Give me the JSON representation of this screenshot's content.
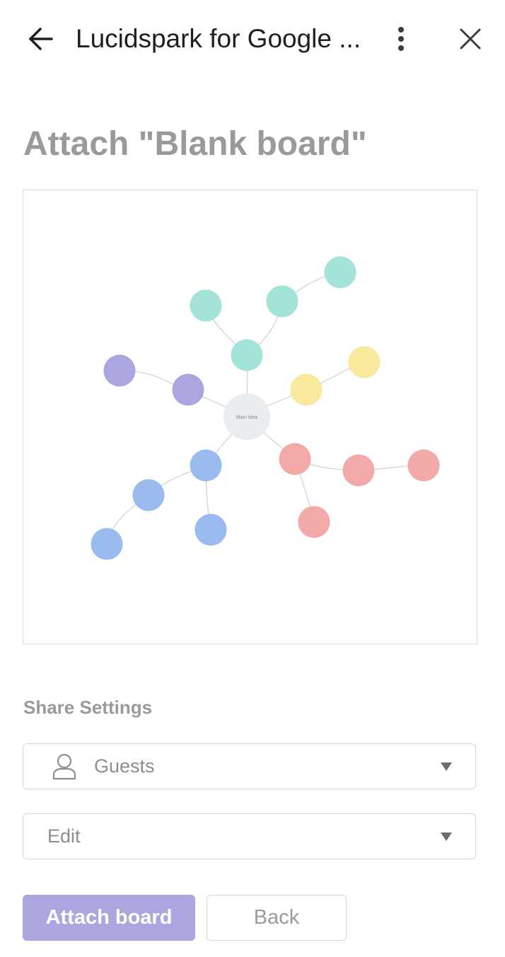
{
  "header": {
    "title": "Lucidspark for Google ...",
    "back_icon": "arrow-left-icon",
    "menu_icon": "more-vertical-icon",
    "close_icon": "close-icon"
  },
  "page_title": "Attach \"Blank board\"",
  "preview": {
    "center_label": "Main idea",
    "colors": {
      "teal": "#a4e3d8",
      "purple": "#a9a6e0",
      "yellow": "#f9e99c",
      "red": "#f2a9a8",
      "blue": "#99bbee",
      "center": "#eaedf0"
    }
  },
  "share_settings": {
    "label": "Share Settings",
    "audience": {
      "value": "Guests",
      "icon": "user-icon"
    },
    "permission": {
      "value": "Edit"
    }
  },
  "actions": {
    "attach_label": "Attach board",
    "back_label": "Back",
    "attach_color": "#a9a6e0"
  }
}
